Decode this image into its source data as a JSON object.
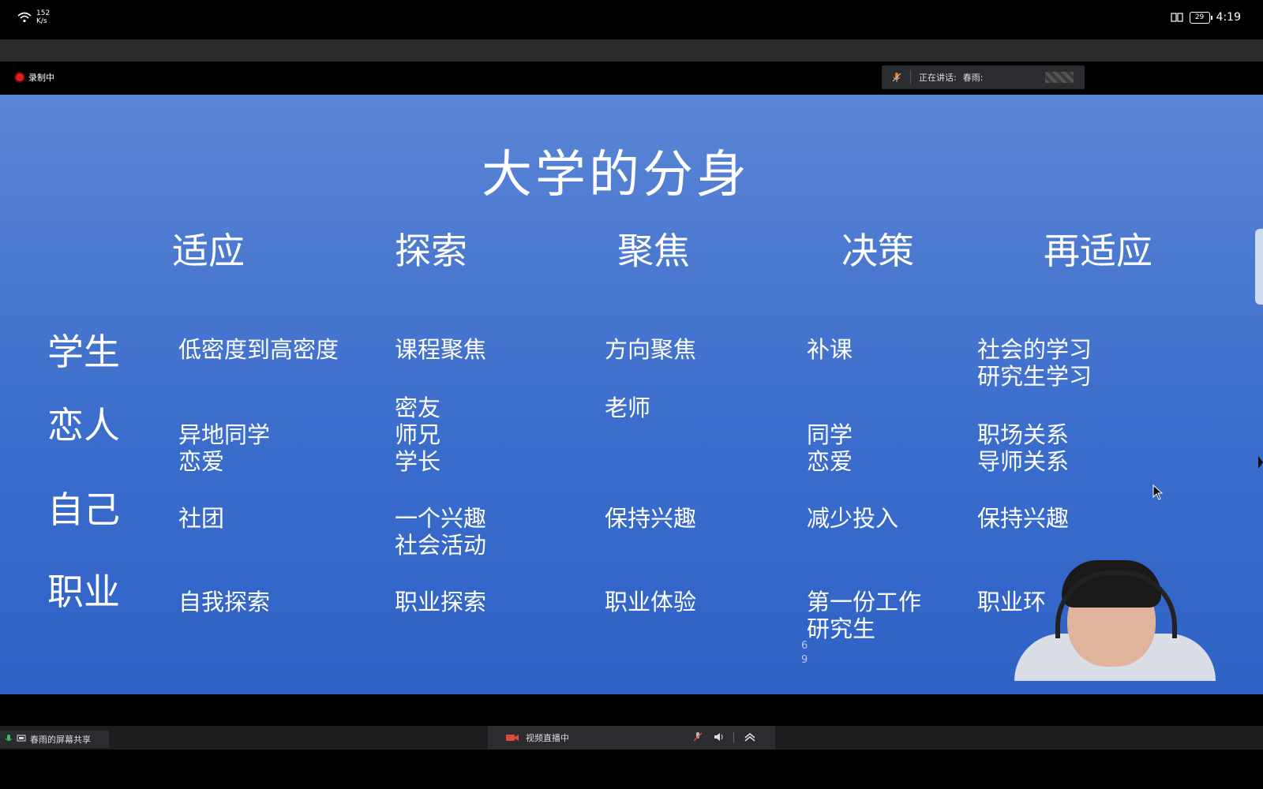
{
  "status_bar": {
    "net_speed_value": "152",
    "net_speed_unit": "K/s",
    "battery": "29",
    "time": "4:19",
    "icons": [
      "wifi-icon",
      "book-icon",
      "battery-icon"
    ]
  },
  "meeting": {
    "recording_label": "录制中",
    "speaking_label": "正在讲话:",
    "speaker_name": "春雨:"
  },
  "slide": {
    "title": "大学的分身",
    "columns": [
      "适应",
      "探索",
      "聚焦",
      "决策",
      "再适应"
    ],
    "rows": [
      "学生",
      "恋人",
      "自己",
      "职业"
    ],
    "cells": {
      "r1c1": "低密度到高密度",
      "r1c2": "课程聚焦",
      "r1c3": "方向聚焦",
      "r1c4": "补课",
      "r1c5": "社会的学习\n研究生学习",
      "r2c1": "异地同学\n恋爱",
      "r2c2": "密友\n师兄\n学长",
      "r2c3": "老师",
      "r2c4": "同学\n恋爱",
      "r2c5": "职场关系\n导师关系",
      "r3c1": "社团",
      "r3c2": "一个兴趣\n社会活动",
      "r3c3": "保持兴趣",
      "r3c4": "减少投入",
      "r3c5": "保持兴趣",
      "r4c1": "自我探索",
      "r4c2": "职业探索",
      "r4c3": "职业体验",
      "r4c4": "第一份工作\n研究生",
      "r4c5": "职业环"
    },
    "page_number": "6\n9"
  },
  "bottom_bar": {
    "share_label": "春雨的屏幕共享",
    "live_label": "视频直播中"
  },
  "colors": {
    "slide_top": "#5b86d6",
    "slide_bottom": "#2f62c6",
    "record_red": "#e02020"
  }
}
